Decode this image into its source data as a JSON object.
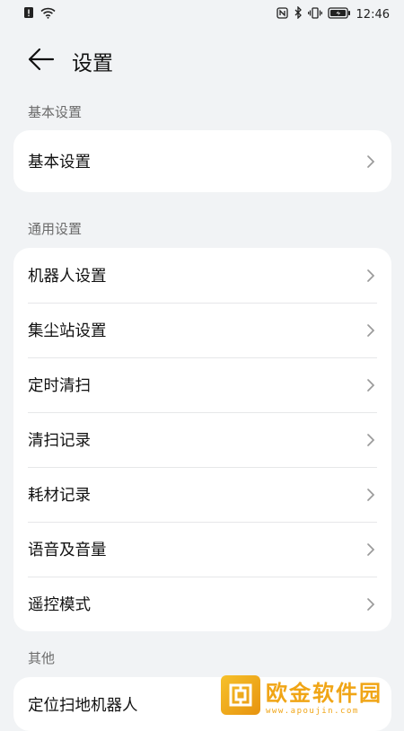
{
  "status_bar": {
    "time": "12:46",
    "left_icons": [
      "alert-icon",
      "wifi-icon"
    ],
    "right_icons": [
      "nfc-icon",
      "bluetooth-icon",
      "vibrate-icon",
      "battery-charging-icon"
    ]
  },
  "header": {
    "back_icon": "back-arrow-icon",
    "title": "设置"
  },
  "sections": {
    "basic": {
      "label": "基本设置",
      "items": [
        {
          "label": "基本设置"
        }
      ]
    },
    "general": {
      "label": "通用设置",
      "items": [
        {
          "label": "机器人设置"
        },
        {
          "label": "集尘站设置"
        },
        {
          "label": "定时清扫"
        },
        {
          "label": "清扫记录"
        },
        {
          "label": "耗材记录"
        },
        {
          "label": "语音及音量"
        },
        {
          "label": "遥控模式"
        }
      ]
    },
    "other": {
      "label": "其他",
      "items": [
        {
          "label": "定位扫地机器人"
        }
      ]
    }
  },
  "watermark": {
    "text": "欧金软件园",
    "url": "www.apoujin.com"
  },
  "colors": {
    "background": "#f1f3f5",
    "card": "#ffffff",
    "section_label": "#6b6b6b",
    "watermark": "#f0a516"
  }
}
